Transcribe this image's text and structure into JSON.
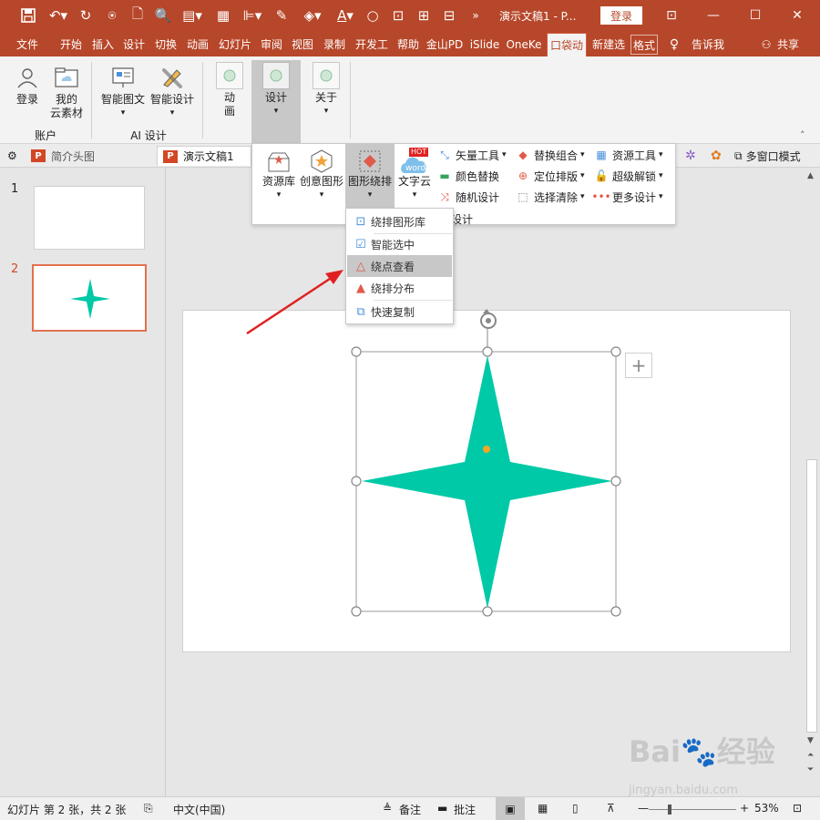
{
  "titlebar": {
    "doc_title": "演示文稿1 - P...",
    "login": "登录",
    "quick_access_icons": [
      "save-icon",
      "undo-icon",
      "redo-icon",
      "present-icon",
      "new-icon",
      "print-preview-icon",
      "open-icon",
      "align-icon",
      "eyedropper-icon",
      "fill-icon",
      "font-color-icon",
      "shape-circle-icon",
      "shape-icon",
      "more-icon"
    ]
  },
  "tabs": [
    "文件",
    "开始",
    "插入",
    "设计",
    "切换",
    "动画",
    "幻灯片",
    "审阅",
    "视图",
    "录制",
    "开发工",
    "帮助",
    "金山PD",
    "iSlide",
    "OneKe",
    "口袋动",
    "新建选",
    "格式",
    "告诉我",
    "共享"
  ],
  "ribbon": {
    "groups": [
      {
        "label": "账户",
        "buttons": [
          "登录",
          "我的云素材"
        ]
      },
      {
        "label": "AI 设计",
        "buttons": [
          "智能图文",
          "智能设计"
        ]
      },
      {
        "label": "",
        "buttons": [
          "动画",
          "设计",
          "关于"
        ]
      }
    ],
    "anim_line1": "动",
    "anim_line2": "画",
    "my_line1": "我的",
    "my_line2": "云素材"
  },
  "doctabs": {
    "tab1": "简介头图",
    "tab2": "演示文稿1",
    "multi_window": "多窗口模式"
  },
  "slides": {
    "items": [
      {
        "number": "1"
      },
      {
        "number": "2"
      }
    ],
    "selected": 2
  },
  "design_panel": {
    "big_buttons": [
      "资源库",
      "创意图形",
      "图形绕排",
      "文字云"
    ],
    "hot_badge": "HOT",
    "word_badge": "word",
    "col1": [
      "矢量工具",
      "颜色替换",
      "随机设计"
    ],
    "col2": [
      "替换组合",
      "定位排版",
      "选择清除"
    ],
    "col3": [
      "资源工具",
      "超级解锁",
      "更多设计"
    ],
    "group_label": "设计"
  },
  "context_menu": {
    "items": [
      "绕排图形库",
      "智能选中",
      "绕点查看",
      "绕排分布",
      "快速复制"
    ],
    "highlighted": "绕点查看"
  },
  "shape": {
    "type": "four-point-star",
    "fill": "#00c9a7"
  },
  "statusbar": {
    "slide_info": "幻灯片 第 2 张，共 2 张",
    "language": "中文(中国)",
    "notes": "备注",
    "comments": "批注",
    "zoom": "53%",
    "zoom_level": 0.53
  },
  "colors": {
    "accent": "#b7472a",
    "star": "#00c9a7",
    "arrow": "#e02020",
    "selected_thumb": "#e2714f"
  },
  "watermark": {
    "logo": "Bai🐾经验",
    "url": "jingyan.baidu.com"
  }
}
